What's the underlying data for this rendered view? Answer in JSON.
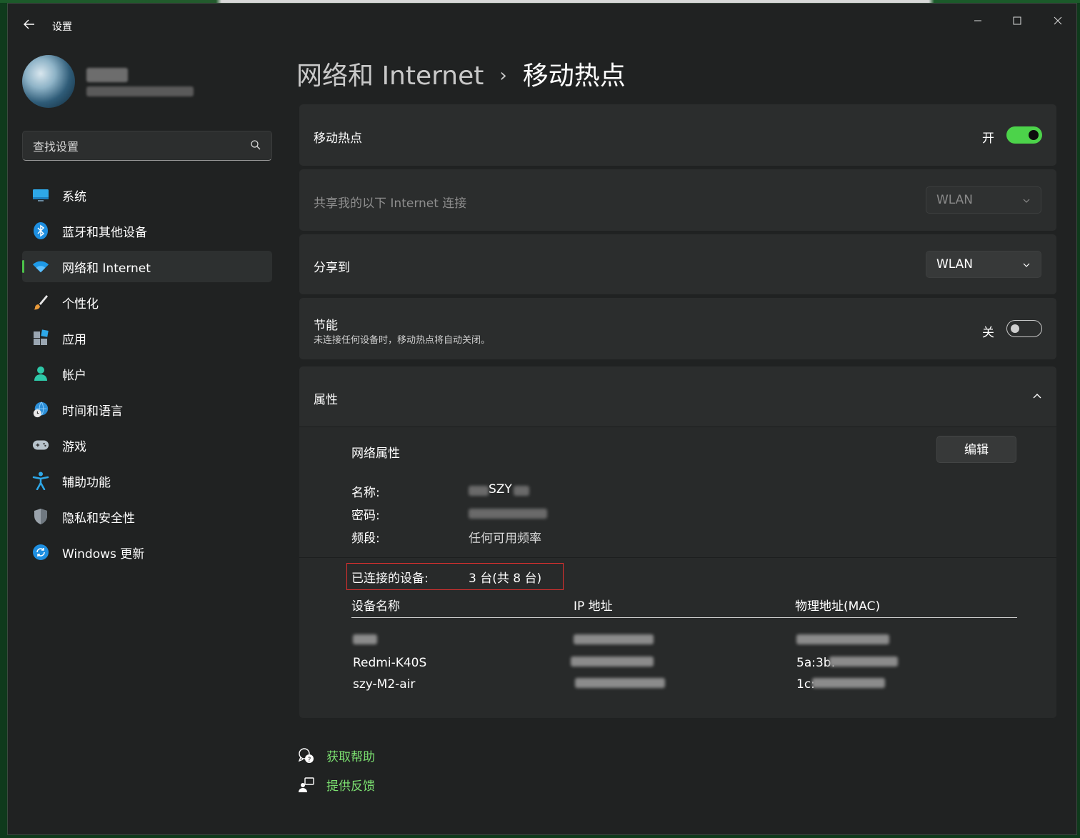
{
  "window": {
    "title": "设置",
    "back_icon": "back-arrow-icon",
    "minimize_glyph": "—",
    "maximize_glyph": "☐",
    "close_glyph": "✕"
  },
  "search": {
    "placeholder": "查找设置",
    "icon": "search-icon"
  },
  "sidebar": {
    "items": [
      {
        "label": "系统",
        "icon": "system-display-icon",
        "selected": false
      },
      {
        "label": "蓝牙和其他设备",
        "icon": "bluetooth-icon",
        "selected": false
      },
      {
        "label": "网络和 Internet",
        "icon": "wifi-icon",
        "selected": true
      },
      {
        "label": "个性化",
        "icon": "paintbrush-icon",
        "selected": false
      },
      {
        "label": "应用",
        "icon": "apps-icon",
        "selected": false
      },
      {
        "label": "帐户",
        "icon": "account-icon",
        "selected": false
      },
      {
        "label": "时间和语言",
        "icon": "time-language-icon",
        "selected": false
      },
      {
        "label": "游戏",
        "icon": "gamepad-icon",
        "selected": false
      },
      {
        "label": "辅助功能",
        "icon": "accessibility-icon",
        "selected": false
      },
      {
        "label": "隐私和安全性",
        "icon": "shield-icon",
        "selected": false
      },
      {
        "label": "Windows 更新",
        "icon": "windows-update-icon",
        "selected": false
      }
    ]
  },
  "breadcrumb": {
    "parent": "网络和 Internet",
    "separator": "›",
    "current": "移动热点"
  },
  "hotspot": {
    "title": "移动热点",
    "state_label": "开",
    "on": true
  },
  "share_from": {
    "label": "共享我的以下 Internet 连接",
    "value": "WLAN",
    "disabled": true
  },
  "share_to": {
    "label": "分享到",
    "value": "WLAN"
  },
  "power_saving": {
    "title": "节能",
    "description": "未连接任何设备时，移动热点将自动关闭。",
    "state_label": "关",
    "on": false
  },
  "properties": {
    "title": "属性",
    "network_props_label": "网络属性",
    "edit_label": "编辑",
    "name_label": "名称:",
    "name_visible_fragment": "SZY",
    "password_label": "密码:",
    "band_label": "频段:",
    "band_value": "任何可用频率",
    "connected_label": "已连接的设备:",
    "connected_value": "3 台(共 8 台)",
    "table_headers": [
      "设备名称",
      "IP 地址",
      "物理地址(MAC)"
    ],
    "devices": [
      {
        "name": "",
        "ip": "",
        "mac": ""
      },
      {
        "name": "Redmi-K40S",
        "ip": "",
        "mac": "5a:3b:"
      },
      {
        "name": "szy-M2-air",
        "ip": "",
        "mac": "1c:"
      }
    ]
  },
  "help": {
    "get_help": "获取帮助",
    "feedback": "提供反馈"
  },
  "colors": {
    "accent": "#4cd34a",
    "link": "#7be070",
    "highlight_box": "#e0302f",
    "window_bg": "#202222",
    "card_bg": "#2b2d2d"
  }
}
